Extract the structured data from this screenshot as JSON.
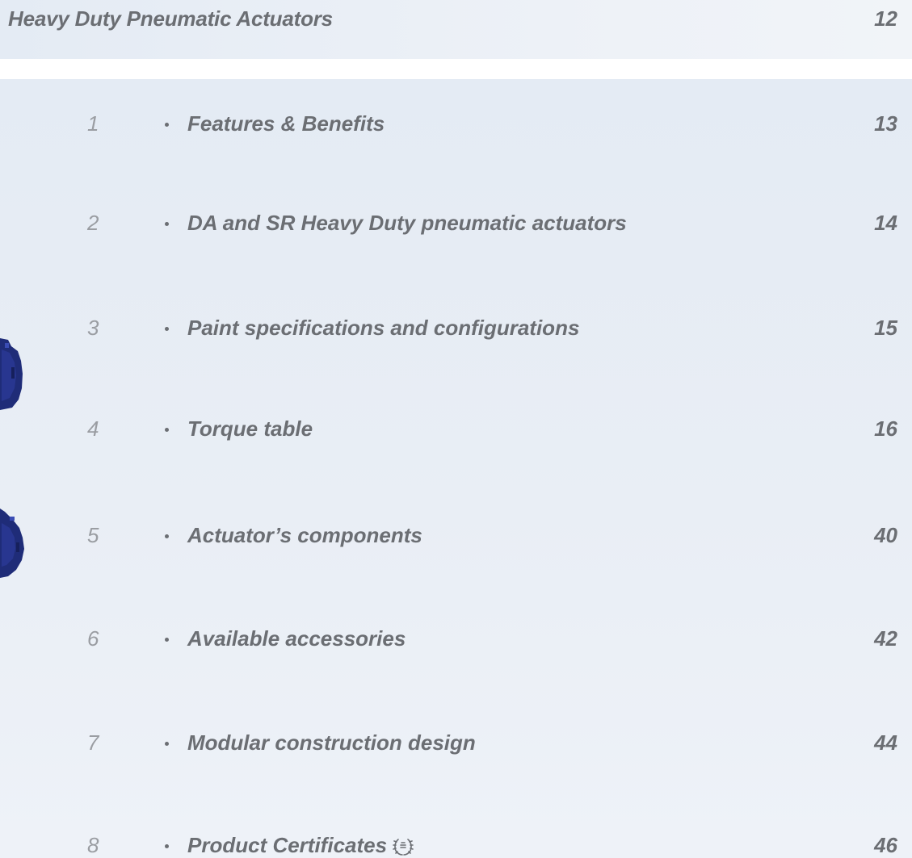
{
  "header": {
    "title": "Heavy Duty Pneumatic Actuators",
    "page": "12"
  },
  "toc": [
    {
      "number": "1",
      "label": "Features & Benefits",
      "page": "13"
    },
    {
      "number": "2",
      "label": "DA and SR Heavy Duty pneumatic actuators",
      "page": "14"
    },
    {
      "number": "3",
      "label": "Paint specifications and configurations",
      "page": "15"
    },
    {
      "number": "4",
      "label": "Torque table",
      "page": "16"
    },
    {
      "number": "5",
      "label": "Actuator’s components",
      "page": "40"
    },
    {
      "number": "6",
      "label": "Available accessories",
      "page": "42"
    },
    {
      "number": "7",
      "label": "Modular construction design",
      "page": "44"
    },
    {
      "number": "8",
      "label": "Product Certificates",
      "page": "46",
      "icon": "laurel-certificate-icon"
    }
  ],
  "colors": {
    "text": "#6b6e73",
    "number": "#9a9da2",
    "panel": "#e7edf5",
    "actuator": "#1f2c78"
  }
}
